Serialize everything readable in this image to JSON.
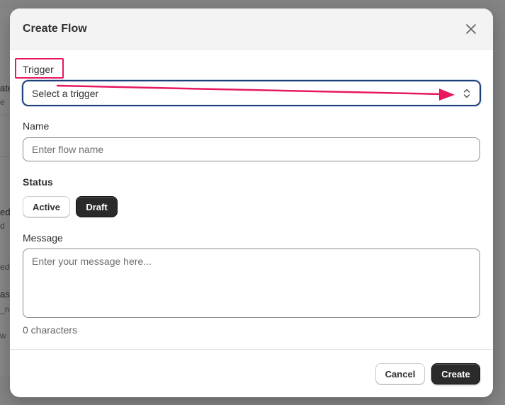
{
  "background": {
    "fragments": [
      "ate",
      "e",
      "ed",
      "d",
      "ed",
      "as",
      "_n",
      "w"
    ]
  },
  "modal": {
    "title": "Create Flow",
    "trigger": {
      "label": "Trigger",
      "selected": "Select a trigger"
    },
    "name": {
      "label": "Name",
      "placeholder": "Enter flow name",
      "value": ""
    },
    "status": {
      "label": "Status",
      "options": [
        "Active",
        "Draft"
      ],
      "selected": "Draft"
    },
    "message": {
      "label": "Message",
      "placeholder": "Enter your message here...",
      "value": ""
    },
    "char_count": "0 characters",
    "buttons": {
      "cancel": "Cancel",
      "create": "Create"
    }
  },
  "annotation": {
    "color": "#e8185f",
    "icon": "arrow-right-icon"
  },
  "colors": {
    "primary_button": "#2b2b2b",
    "focus_border": "#1f3f7a"
  }
}
